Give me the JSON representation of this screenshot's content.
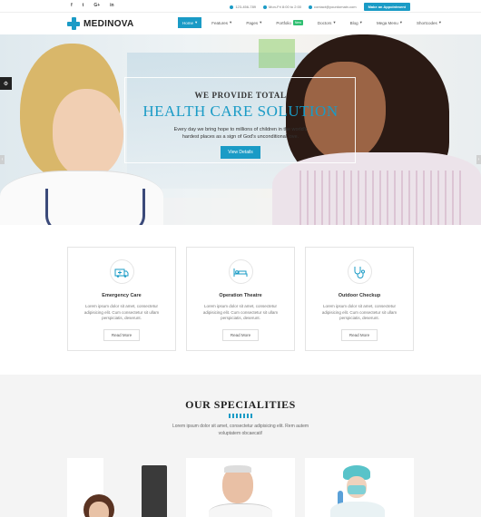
{
  "topbar": {
    "social": [
      {
        "icon": "facebook-icon",
        "glyph": "f"
      },
      {
        "icon": "twitter-icon",
        "glyph": "t"
      },
      {
        "icon": "google-plus-icon",
        "glyph": "G+"
      },
      {
        "icon": "linkedin-icon",
        "glyph": "in"
      }
    ],
    "phone": "123-456-789",
    "hours": "Mon-Fri 8:00 to 2:00",
    "email": "contact@yourdomain.com",
    "appointment_label": "Make an Appointment"
  },
  "navbar": {
    "logo_text": "MEDINOVA",
    "menu": [
      {
        "label": "Home",
        "active": true
      },
      {
        "label": "Features",
        "active": false
      },
      {
        "label": "Pages",
        "active": false
      },
      {
        "label": "Portfolio",
        "active": false,
        "badge": "New"
      },
      {
        "label": "Doctors",
        "active": false
      },
      {
        "label": "Blog",
        "active": false
      },
      {
        "label": "Mega Menu",
        "active": false
      },
      {
        "label": "Shortcodes",
        "active": false
      }
    ],
    "dropdown_glyph": "▾"
  },
  "hero": {
    "kicker": "WE PROVIDE TOTAL",
    "headline": "HEALTH CARE SOLUTION",
    "sub_line1": "Every day we bring hope to millions of children in the world's",
    "sub_line2": "hardest places as a sign of God's unconditional love.",
    "button_label": "View Details",
    "side_tab_glyph": "⚙",
    "arrow_left": "‹",
    "arrow_right": "›"
  },
  "services": [
    {
      "icon": "ambulance-icon",
      "title": "Emergency Care",
      "desc": "Lorem ipsum dolor sit amet, consectetur adipisicing elit. Cum consectetur sit ullam perspiciatis, deserunt.",
      "button": "Read More"
    },
    {
      "icon": "hospital-bed-icon",
      "title": "Operation Theatre",
      "desc": "Lorem ipsum dolor sit amet, consectetur adipisicing elit. Cum consectetur sit ullam perspiciatis, deserunt.",
      "button": "Read More"
    },
    {
      "icon": "stethoscope-icon",
      "title": "Outdoor Checkup",
      "desc": "Lorem ipsum dolor sit amet, consectetur adipisicing elit. Cum consectetur sit ullam perspiciatis, deserunt.",
      "button": "Read More"
    }
  ],
  "specialities": {
    "title": "OUR SPECIALITIES",
    "desc_line1": "Lorem ipsum dolor sit amet, consectetur adipisicing elit. Rem autem",
    "desc_line2": "voluptatem obcaecati!"
  },
  "colors": {
    "accent": "#1a9bc6",
    "new_badge": "#2fbf71"
  }
}
